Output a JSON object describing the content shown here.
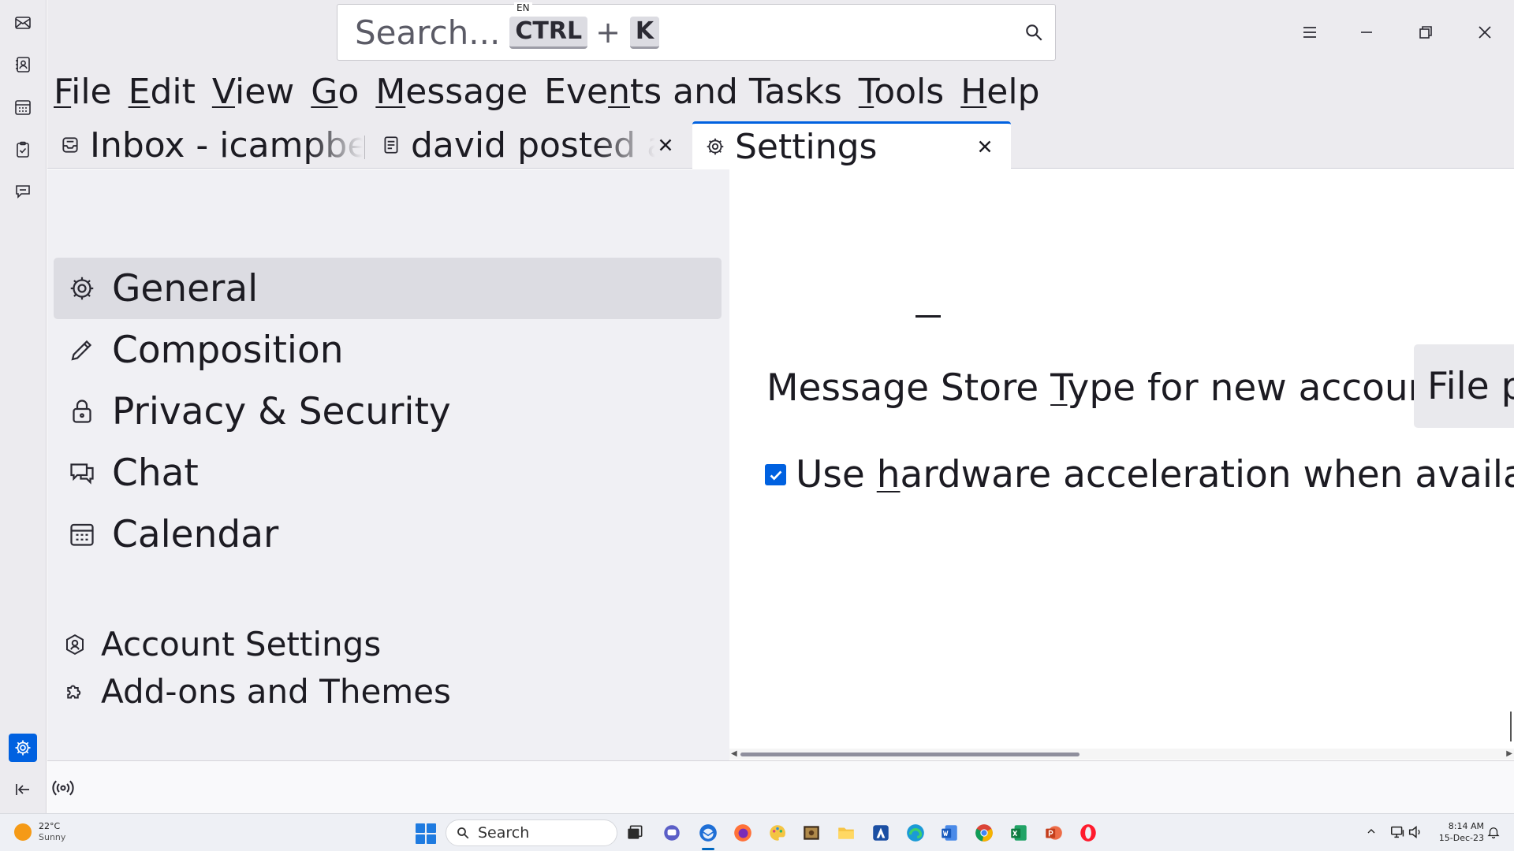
{
  "window": {
    "search_placeholder": "Search...",
    "search_shortcut_mod": "CTRL",
    "search_shortcut_plus": "+",
    "search_shortcut_key": "K",
    "language_indicator": "EN"
  },
  "menubar": {
    "items": [
      {
        "pre": "",
        "u": "F",
        "post": "ile"
      },
      {
        "pre": "",
        "u": "E",
        "post": "dit"
      },
      {
        "pre": "",
        "u": "V",
        "post": "iew"
      },
      {
        "pre": "",
        "u": "G",
        "post": "o"
      },
      {
        "pre": "",
        "u": "M",
        "post": "essage"
      },
      {
        "pre": "Eve",
        "u": "n",
        "post": "ts and Tasks"
      },
      {
        "pre": "",
        "u": "T",
        "post": "ools"
      },
      {
        "pre": "",
        "u": "H",
        "post": "elp"
      }
    ]
  },
  "tabs": {
    "inbox": "Inbox - icampbell@",
    "david": "david posted an update",
    "settings": "Settings"
  },
  "categories": {
    "general": "General",
    "composition": "Composition",
    "privacy": "Privacy & Security",
    "chat": "Chat",
    "calendar": "Calendar",
    "account_settings": "Account Settings",
    "addons": "Add-ons and Themes"
  },
  "content": {
    "dash": "–",
    "store_label_pre": "Message Store ",
    "store_label_u": "T",
    "store_label_post": "ype for new accounts:",
    "store_value": "File per folder (mbox)",
    "hwaccel_pre": "Use ",
    "hwaccel_u": "h",
    "hwaccel_post": "ardware acceleration when available",
    "hwaccel_checked": true
  },
  "taskbar": {
    "temperature": "22°C",
    "condition": "Sunny",
    "search_label": "Search",
    "time": "8:14 AM",
    "date": "15-Dec-23"
  },
  "colors": {
    "accent": "#0061e0",
    "selected_category": "#dcdce2",
    "chrome": "#ecebef"
  }
}
